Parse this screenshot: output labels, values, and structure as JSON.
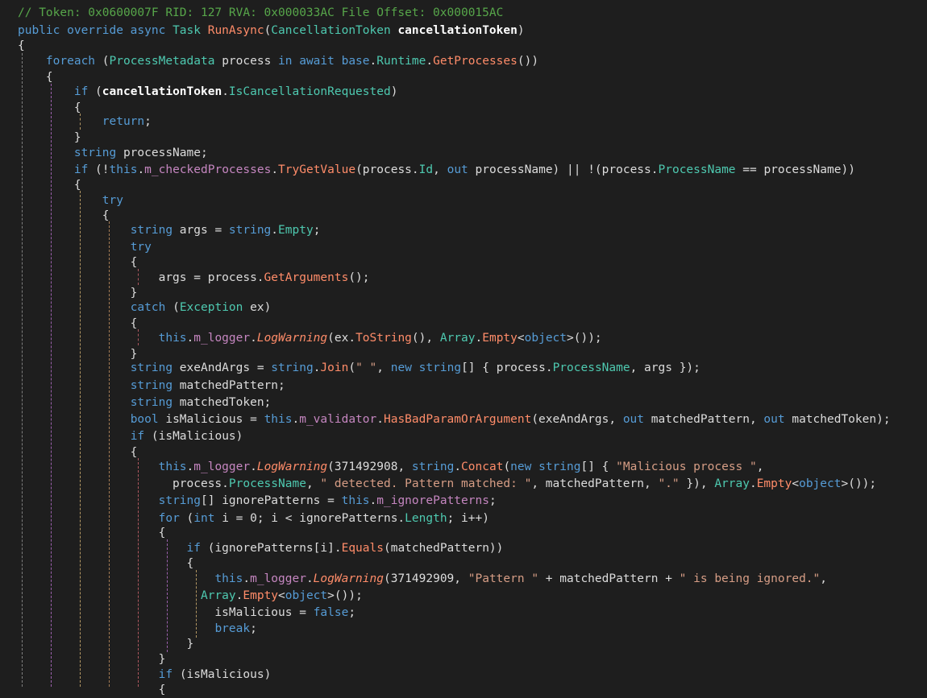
{
  "colors": {
    "background": "#1e1e1e",
    "text": "#dcdcdc",
    "keyword": "#569cd6",
    "type": "#4ec9b0",
    "method": "#ff8c69",
    "property": "#4ec9b0",
    "field": "#c586c0",
    "string": "#d69d85",
    "comment": "#57a64a",
    "param": "#ffffff"
  },
  "code": {
    "lines": [
      [
        [
          "// Token: 0x0600007F RID: 127 RVA: 0x000033AC File Offset: 0x000015AC",
          "comment"
        ]
      ],
      [
        [
          "public override async ",
          "kw"
        ],
        [
          "Task ",
          "type"
        ],
        [
          "RunAsync",
          "method"
        ],
        [
          "(",
          "pl"
        ],
        [
          "CancellationToken ",
          "type"
        ],
        [
          "cancellationToken",
          "param"
        ],
        [
          ")",
          "pl"
        ]
      ],
      [
        [
          "{",
          "pl"
        ]
      ],
      [
        [
          "    ",
          "pl"
        ],
        [
          "foreach ",
          "kw"
        ],
        [
          "(",
          "pl"
        ],
        [
          "ProcessMetadata ",
          "type"
        ],
        [
          "process ",
          "pl"
        ],
        [
          "in await base",
          "kw"
        ],
        [
          ".",
          "pl"
        ],
        [
          "Runtime",
          "prop"
        ],
        [
          ".",
          "pl"
        ],
        [
          "GetProcesses",
          "method"
        ],
        [
          "())",
          "pl"
        ]
      ],
      [
        [
          "    {",
          "pl"
        ]
      ],
      [
        [
          "        ",
          "pl"
        ],
        [
          "if ",
          "kw"
        ],
        [
          "(",
          "pl"
        ],
        [
          "cancellationToken",
          "param"
        ],
        [
          ".",
          "pl"
        ],
        [
          "IsCancellationRequested",
          "prop"
        ],
        [
          ")",
          "pl"
        ]
      ],
      [
        [
          "        {",
          "pl"
        ]
      ],
      [
        [
          "            ",
          "pl"
        ],
        [
          "return",
          "kw"
        ],
        [
          ";",
          "pl"
        ]
      ],
      [
        [
          "        }",
          "pl"
        ]
      ],
      [
        [
          "        ",
          "pl"
        ],
        [
          "string ",
          "kw"
        ],
        [
          "processName;",
          "pl"
        ]
      ],
      [
        [
          "        ",
          "pl"
        ],
        [
          "if ",
          "kw"
        ],
        [
          "(!",
          "pl"
        ],
        [
          "this",
          "kw"
        ],
        [
          ".",
          "pl"
        ],
        [
          "m_checkedProcesses",
          "field"
        ],
        [
          ".",
          "pl"
        ],
        [
          "TryGetValue",
          "method"
        ],
        [
          "(process.",
          "pl"
        ],
        [
          "Id",
          "prop"
        ],
        [
          ", ",
          "pl"
        ],
        [
          "out ",
          "kw"
        ],
        [
          "processName) || !(process.",
          "pl"
        ],
        [
          "ProcessName",
          "prop"
        ],
        [
          " == processName))",
          "pl"
        ]
      ],
      [
        [
          "        {",
          "pl"
        ]
      ],
      [
        [
          "            ",
          "pl"
        ],
        [
          "try",
          "kw"
        ]
      ],
      [
        [
          "            {",
          "pl"
        ]
      ],
      [
        [
          "                ",
          "pl"
        ],
        [
          "string ",
          "kw"
        ],
        [
          "args = ",
          "pl"
        ],
        [
          "string",
          "kw"
        ],
        [
          ".",
          "pl"
        ],
        [
          "Empty",
          "prop"
        ],
        [
          ";",
          "pl"
        ]
      ],
      [
        [
          "                ",
          "pl"
        ],
        [
          "try",
          "kw"
        ]
      ],
      [
        [
          "                {",
          "pl"
        ]
      ],
      [
        [
          "                    args = process.",
          "pl"
        ],
        [
          "GetArguments",
          "method"
        ],
        [
          "();",
          "pl"
        ]
      ],
      [
        [
          "                }",
          "pl"
        ]
      ],
      [
        [
          "                ",
          "pl"
        ],
        [
          "catch ",
          "kw"
        ],
        [
          "(",
          "pl"
        ],
        [
          "Exception ",
          "type"
        ],
        [
          "ex)",
          "pl"
        ]
      ],
      [
        [
          "                {",
          "pl"
        ]
      ],
      [
        [
          "                    ",
          "pl"
        ],
        [
          "this",
          "kw"
        ],
        [
          ".",
          "pl"
        ],
        [
          "m_logger",
          "field"
        ],
        [
          ".",
          "pl"
        ],
        [
          "LogWarning",
          "method-i"
        ],
        [
          "(ex.",
          "pl"
        ],
        [
          "ToString",
          "method"
        ],
        [
          "(), ",
          "pl"
        ],
        [
          "Array",
          "type"
        ],
        [
          ".",
          "pl"
        ],
        [
          "Empty",
          "method"
        ],
        [
          "<",
          "pl"
        ],
        [
          "object",
          "kw"
        ],
        [
          ">());",
          "pl"
        ]
      ],
      [
        [
          "                }",
          "pl"
        ]
      ],
      [
        [
          "                ",
          "pl"
        ],
        [
          "string ",
          "kw"
        ],
        [
          "exeAndArgs = ",
          "pl"
        ],
        [
          "string",
          "kw"
        ],
        [
          ".",
          "pl"
        ],
        [
          "Join",
          "method"
        ],
        [
          "(",
          "pl"
        ],
        [
          "\" \"",
          "str"
        ],
        [
          ", ",
          "pl"
        ],
        [
          "new string",
          "kw"
        ],
        [
          "[] { process.",
          "pl"
        ],
        [
          "ProcessName",
          "prop"
        ],
        [
          ", args });",
          "pl"
        ]
      ],
      [
        [
          "                ",
          "pl"
        ],
        [
          "string ",
          "kw"
        ],
        [
          "matchedPattern;",
          "pl"
        ]
      ],
      [
        [
          "                ",
          "pl"
        ],
        [
          "string ",
          "kw"
        ],
        [
          "matchedToken;",
          "pl"
        ]
      ],
      [
        [
          "                ",
          "pl"
        ],
        [
          "bool ",
          "kw"
        ],
        [
          "isMalicious = ",
          "pl"
        ],
        [
          "this",
          "kw"
        ],
        [
          ".",
          "pl"
        ],
        [
          "m_validator",
          "field"
        ],
        [
          ".",
          "pl"
        ],
        [
          "HasBadParamOrArgument",
          "method"
        ],
        [
          "(exeAndArgs, ",
          "pl"
        ],
        [
          "out ",
          "kw"
        ],
        [
          "matchedPattern, ",
          "pl"
        ],
        [
          "out ",
          "kw"
        ],
        [
          "matchedToken);",
          "pl"
        ]
      ],
      [
        [
          "                ",
          "pl"
        ],
        [
          "if ",
          "kw"
        ],
        [
          "(isMalicious)",
          "pl"
        ]
      ],
      [
        [
          "                {",
          "pl"
        ]
      ],
      [
        [
          "                    ",
          "pl"
        ],
        [
          "this",
          "kw"
        ],
        [
          ".",
          "pl"
        ],
        [
          "m_logger",
          "field"
        ],
        [
          ".",
          "pl"
        ],
        [
          "LogWarning",
          "method-i"
        ],
        [
          "(371492908, ",
          "pl"
        ],
        [
          "string",
          "kw"
        ],
        [
          ".",
          "pl"
        ],
        [
          "Concat",
          "method"
        ],
        [
          "(",
          "pl"
        ],
        [
          "new string",
          "kw"
        ],
        [
          "[] { ",
          "pl"
        ],
        [
          "\"Malicious process \"",
          "str"
        ],
        [
          ",",
          "pl"
        ]
      ],
      [
        [
          "                      process.",
          "pl"
        ],
        [
          "ProcessName",
          "prop"
        ],
        [
          ", ",
          "pl"
        ],
        [
          "\" detected. Pattern matched: \"",
          "str"
        ],
        [
          ", matchedPattern, ",
          "pl"
        ],
        [
          "\".\"",
          "str"
        ],
        [
          " }), ",
          "pl"
        ],
        [
          "Array",
          "type"
        ],
        [
          ".",
          "pl"
        ],
        [
          "Empty",
          "method"
        ],
        [
          "<",
          "pl"
        ],
        [
          "object",
          "kw"
        ],
        [
          ">());",
          "pl"
        ]
      ],
      [
        [
          "                    ",
          "pl"
        ],
        [
          "string",
          "kw"
        ],
        [
          "[] ignorePatterns = ",
          "pl"
        ],
        [
          "this",
          "kw"
        ],
        [
          ".",
          "pl"
        ],
        [
          "m_ignorePatterns",
          "field"
        ],
        [
          ";",
          "pl"
        ]
      ],
      [
        [
          "                    ",
          "pl"
        ],
        [
          "for ",
          "kw"
        ],
        [
          "(",
          "pl"
        ],
        [
          "int ",
          "kw"
        ],
        [
          "i = 0; i < ignorePatterns.",
          "pl"
        ],
        [
          "Length",
          "prop"
        ],
        [
          "; i++)",
          "pl"
        ]
      ],
      [
        [
          "                    {",
          "pl"
        ]
      ],
      [
        [
          "                        ",
          "pl"
        ],
        [
          "if ",
          "kw"
        ],
        [
          "(ignorePatterns[i].",
          "pl"
        ],
        [
          "Equals",
          "method"
        ],
        [
          "(matchedPattern))",
          "pl"
        ]
      ],
      [
        [
          "                        {",
          "pl"
        ]
      ],
      [
        [
          "                            ",
          "pl"
        ],
        [
          "this",
          "kw"
        ],
        [
          ".",
          "pl"
        ],
        [
          "m_logger",
          "field"
        ],
        [
          ".",
          "pl"
        ],
        [
          "LogWarning",
          "method-i"
        ],
        [
          "(371492909, ",
          "pl"
        ],
        [
          "\"Pattern \"",
          "str"
        ],
        [
          " + matchedPattern + ",
          "pl"
        ],
        [
          "\" is being ignored.\"",
          "str"
        ],
        [
          ",",
          "pl"
        ]
      ],
      [
        [
          "                          ",
          "pl"
        ],
        [
          "Array",
          "type"
        ],
        [
          ".",
          "pl"
        ],
        [
          "Empty",
          "method"
        ],
        [
          "<",
          "pl"
        ],
        [
          "object",
          "kw"
        ],
        [
          ">());",
          "pl"
        ]
      ],
      [
        [
          "                            isMalicious = ",
          "pl"
        ],
        [
          "false",
          "kw"
        ],
        [
          ";",
          "pl"
        ]
      ],
      [
        [
          "                            ",
          "pl"
        ],
        [
          "break",
          "kw"
        ],
        [
          ";",
          "pl"
        ]
      ],
      [
        [
          "                        }",
          "pl"
        ]
      ],
      [
        [
          "                    }",
          "pl"
        ]
      ],
      [
        [
          "                    ",
          "pl"
        ],
        [
          "if ",
          "kw"
        ],
        [
          "(isMalicious)",
          "pl"
        ]
      ],
      [
        [
          "                    {",
          "pl"
        ]
      ]
    ]
  }
}
